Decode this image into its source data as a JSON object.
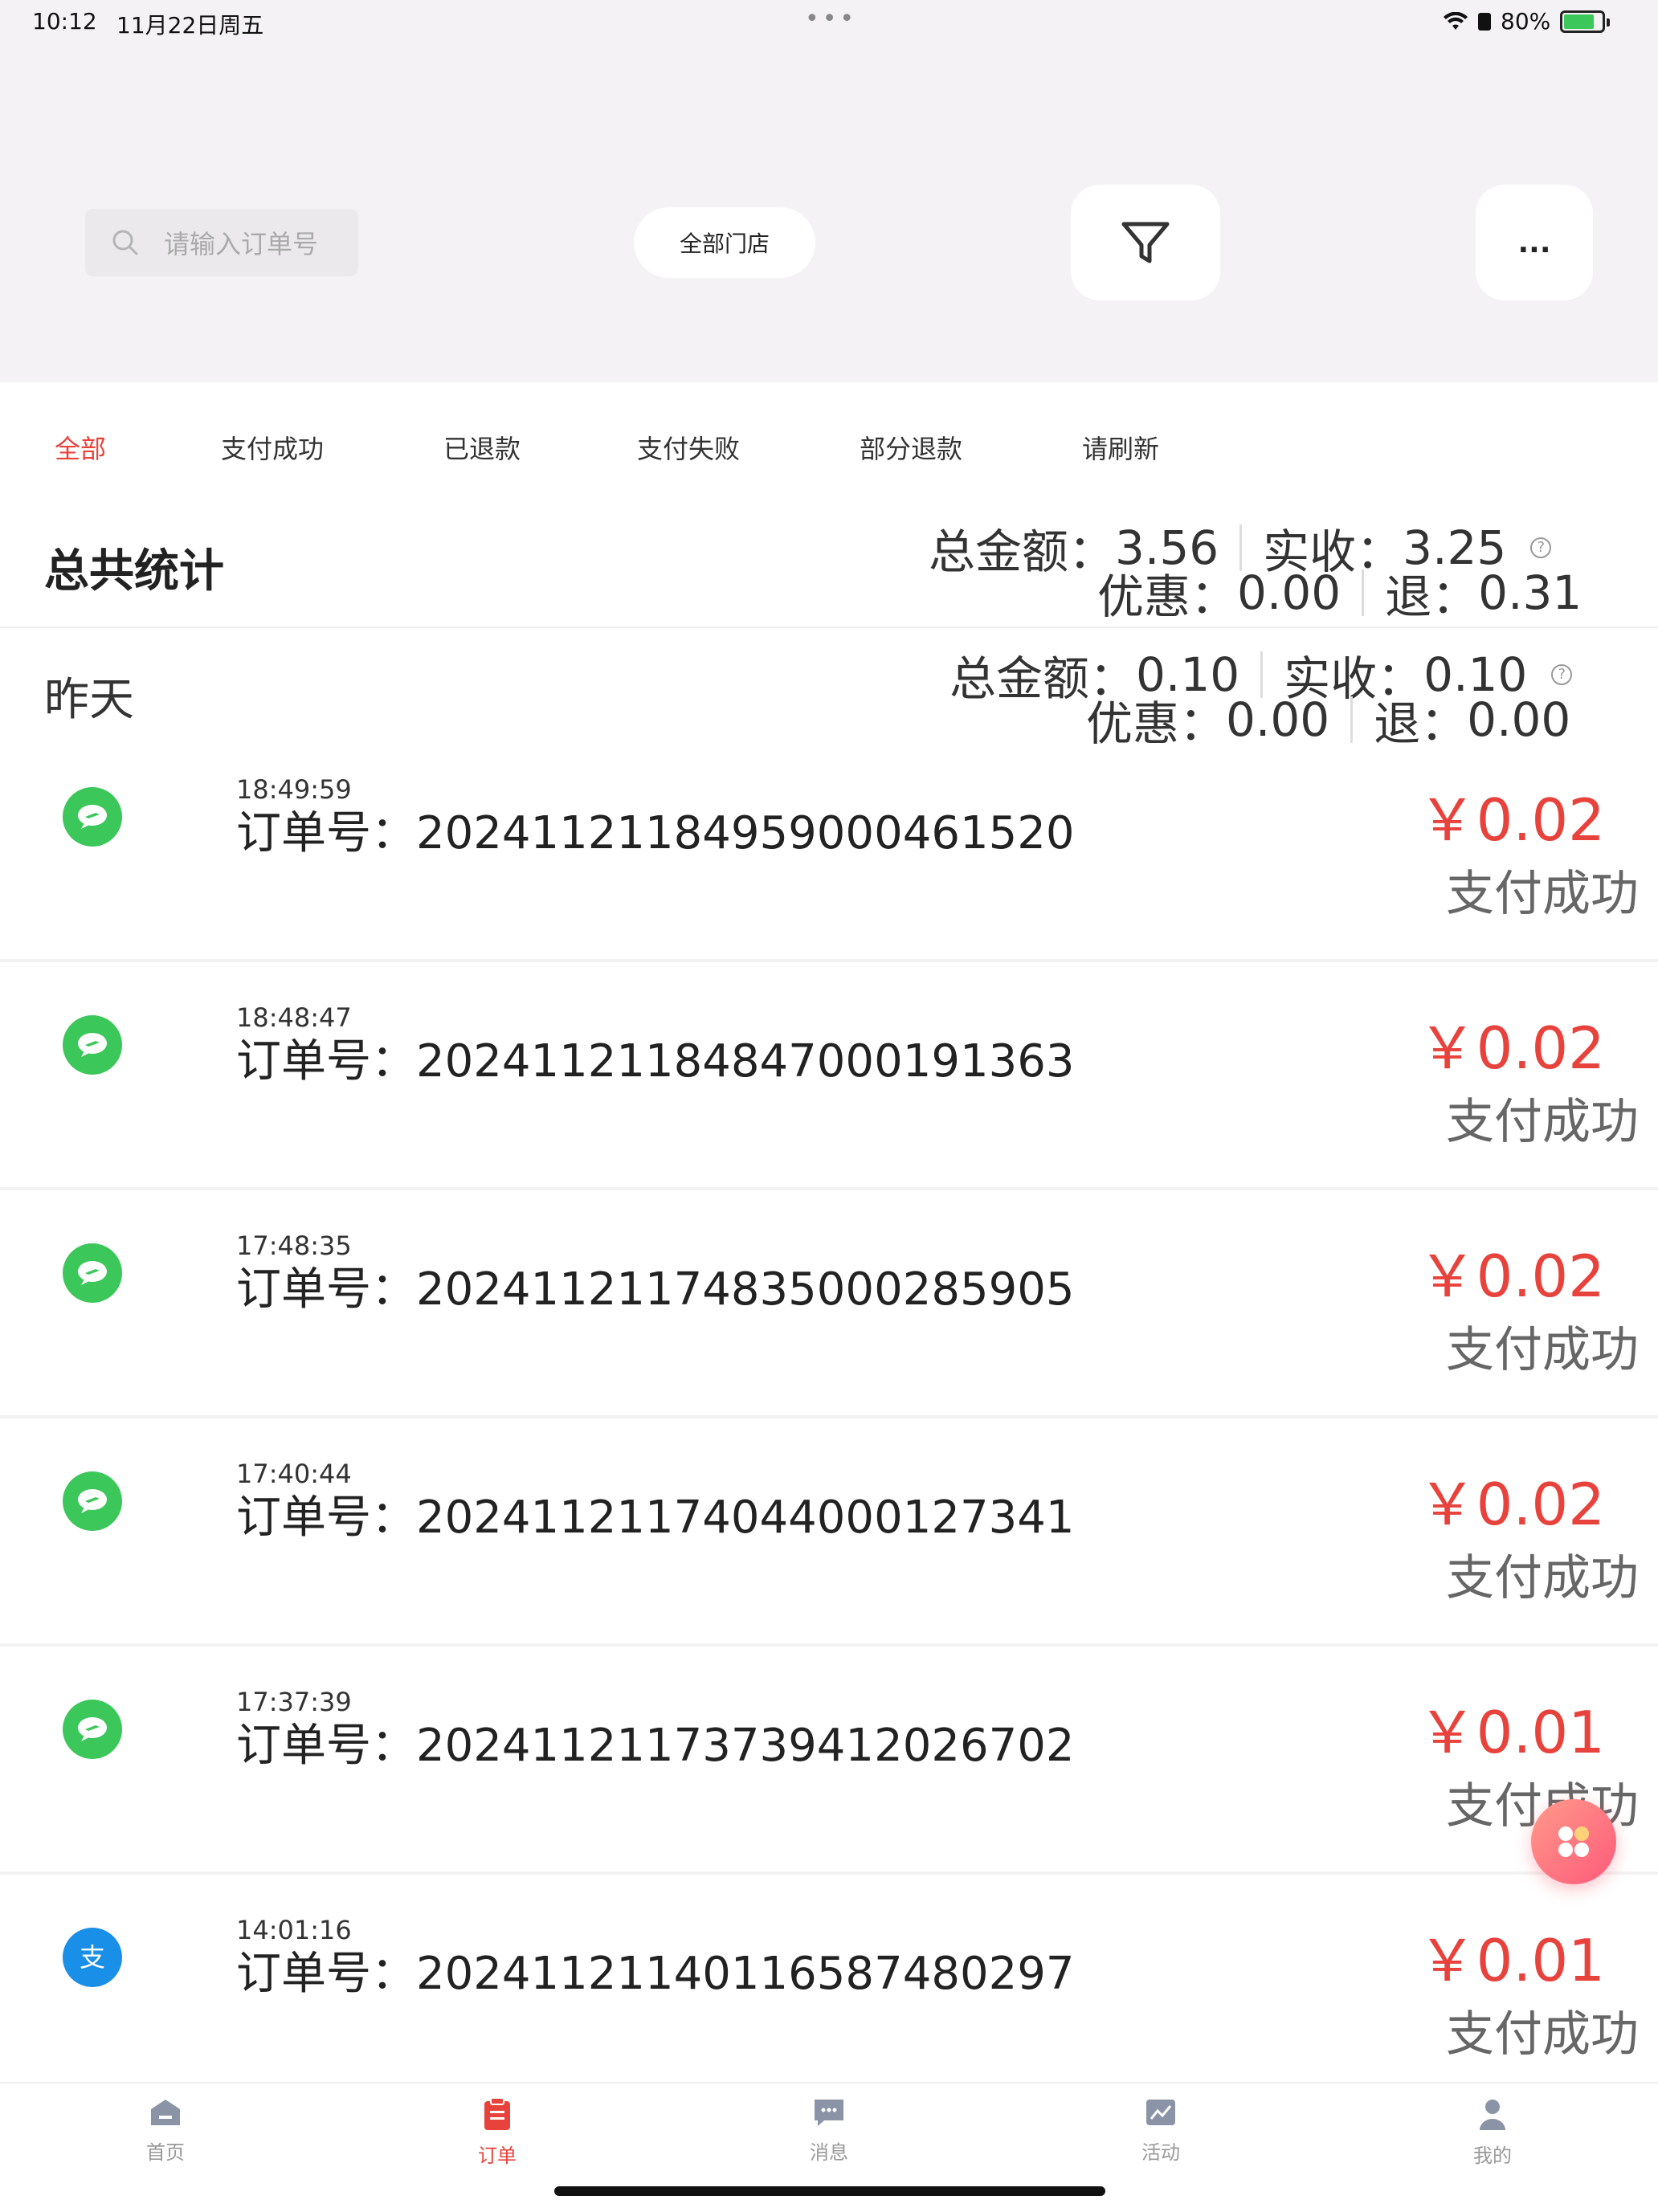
{
  "status_bar": {
    "time": "10:12",
    "date": "11月22日周五",
    "battery": "80%",
    "battery_level": 0.8
  },
  "header": {
    "search_placeholder": "请输入订单号",
    "store_button": "全部门店",
    "more_label": "..."
  },
  "tabs": [
    "全部",
    "支付成功",
    "已退款",
    "支付失败",
    "部分退款",
    "请刷新"
  ],
  "active_tab": 0,
  "summary": {
    "title": "总共统计",
    "total_label": "总金额：",
    "total": "3.56",
    "received_label": "实收：",
    "received": "3.25",
    "discount_label": "优惠：",
    "discount": "0.00",
    "refund_label": "退：",
    "refund": "0.31",
    "help": "?"
  },
  "day": {
    "title": "昨天",
    "total_label": "总金额：",
    "total": "0.10",
    "received_label": "实收：",
    "received": "0.10",
    "discount_label": "优惠：",
    "discount": "0.00",
    "refund_label": "退：",
    "refund": "0.00",
    "help": "?"
  },
  "order_prefix": "订单号：",
  "orders": [
    {
      "time": "18:49:59",
      "order_no": "20241121184959000461520",
      "amount": "￥0.02",
      "status": "支付成功",
      "method": "wechat"
    },
    {
      "time": "18:48:47",
      "order_no": "20241121184847000191363",
      "amount": "￥0.02",
      "status": "支付成功",
      "method": "wechat"
    },
    {
      "time": "17:48:35",
      "order_no": "20241121174835000285905",
      "amount": "￥0.02",
      "status": "支付成功",
      "method": "wechat"
    },
    {
      "time": "17:40:44",
      "order_no": "20241121174044000127341",
      "amount": "￥0.02",
      "status": "支付成功",
      "method": "wechat"
    },
    {
      "time": "17:37:39",
      "order_no": "20241121173739412026702",
      "amount": "￥0.01",
      "status": "支付成功",
      "method": "wechat"
    },
    {
      "time": "14:01:16",
      "order_no": "20241121140116587480297",
      "amount": "￥0.01",
      "status": "支付成功",
      "method": "alipay"
    }
  ],
  "nav": [
    {
      "label": "首页",
      "icon": "home-icon"
    },
    {
      "label": "订单",
      "icon": "order-icon"
    },
    {
      "label": "消息",
      "icon": "message-icon"
    },
    {
      "label": "活动",
      "icon": "activity-icon"
    },
    {
      "label": "我的",
      "icon": "profile-icon"
    }
  ],
  "active_nav": 1,
  "colors": {
    "accent": "#e8423c",
    "wechat": "#3cc75a",
    "alipay": "#1a8fe8",
    "inactive": "#999999"
  }
}
